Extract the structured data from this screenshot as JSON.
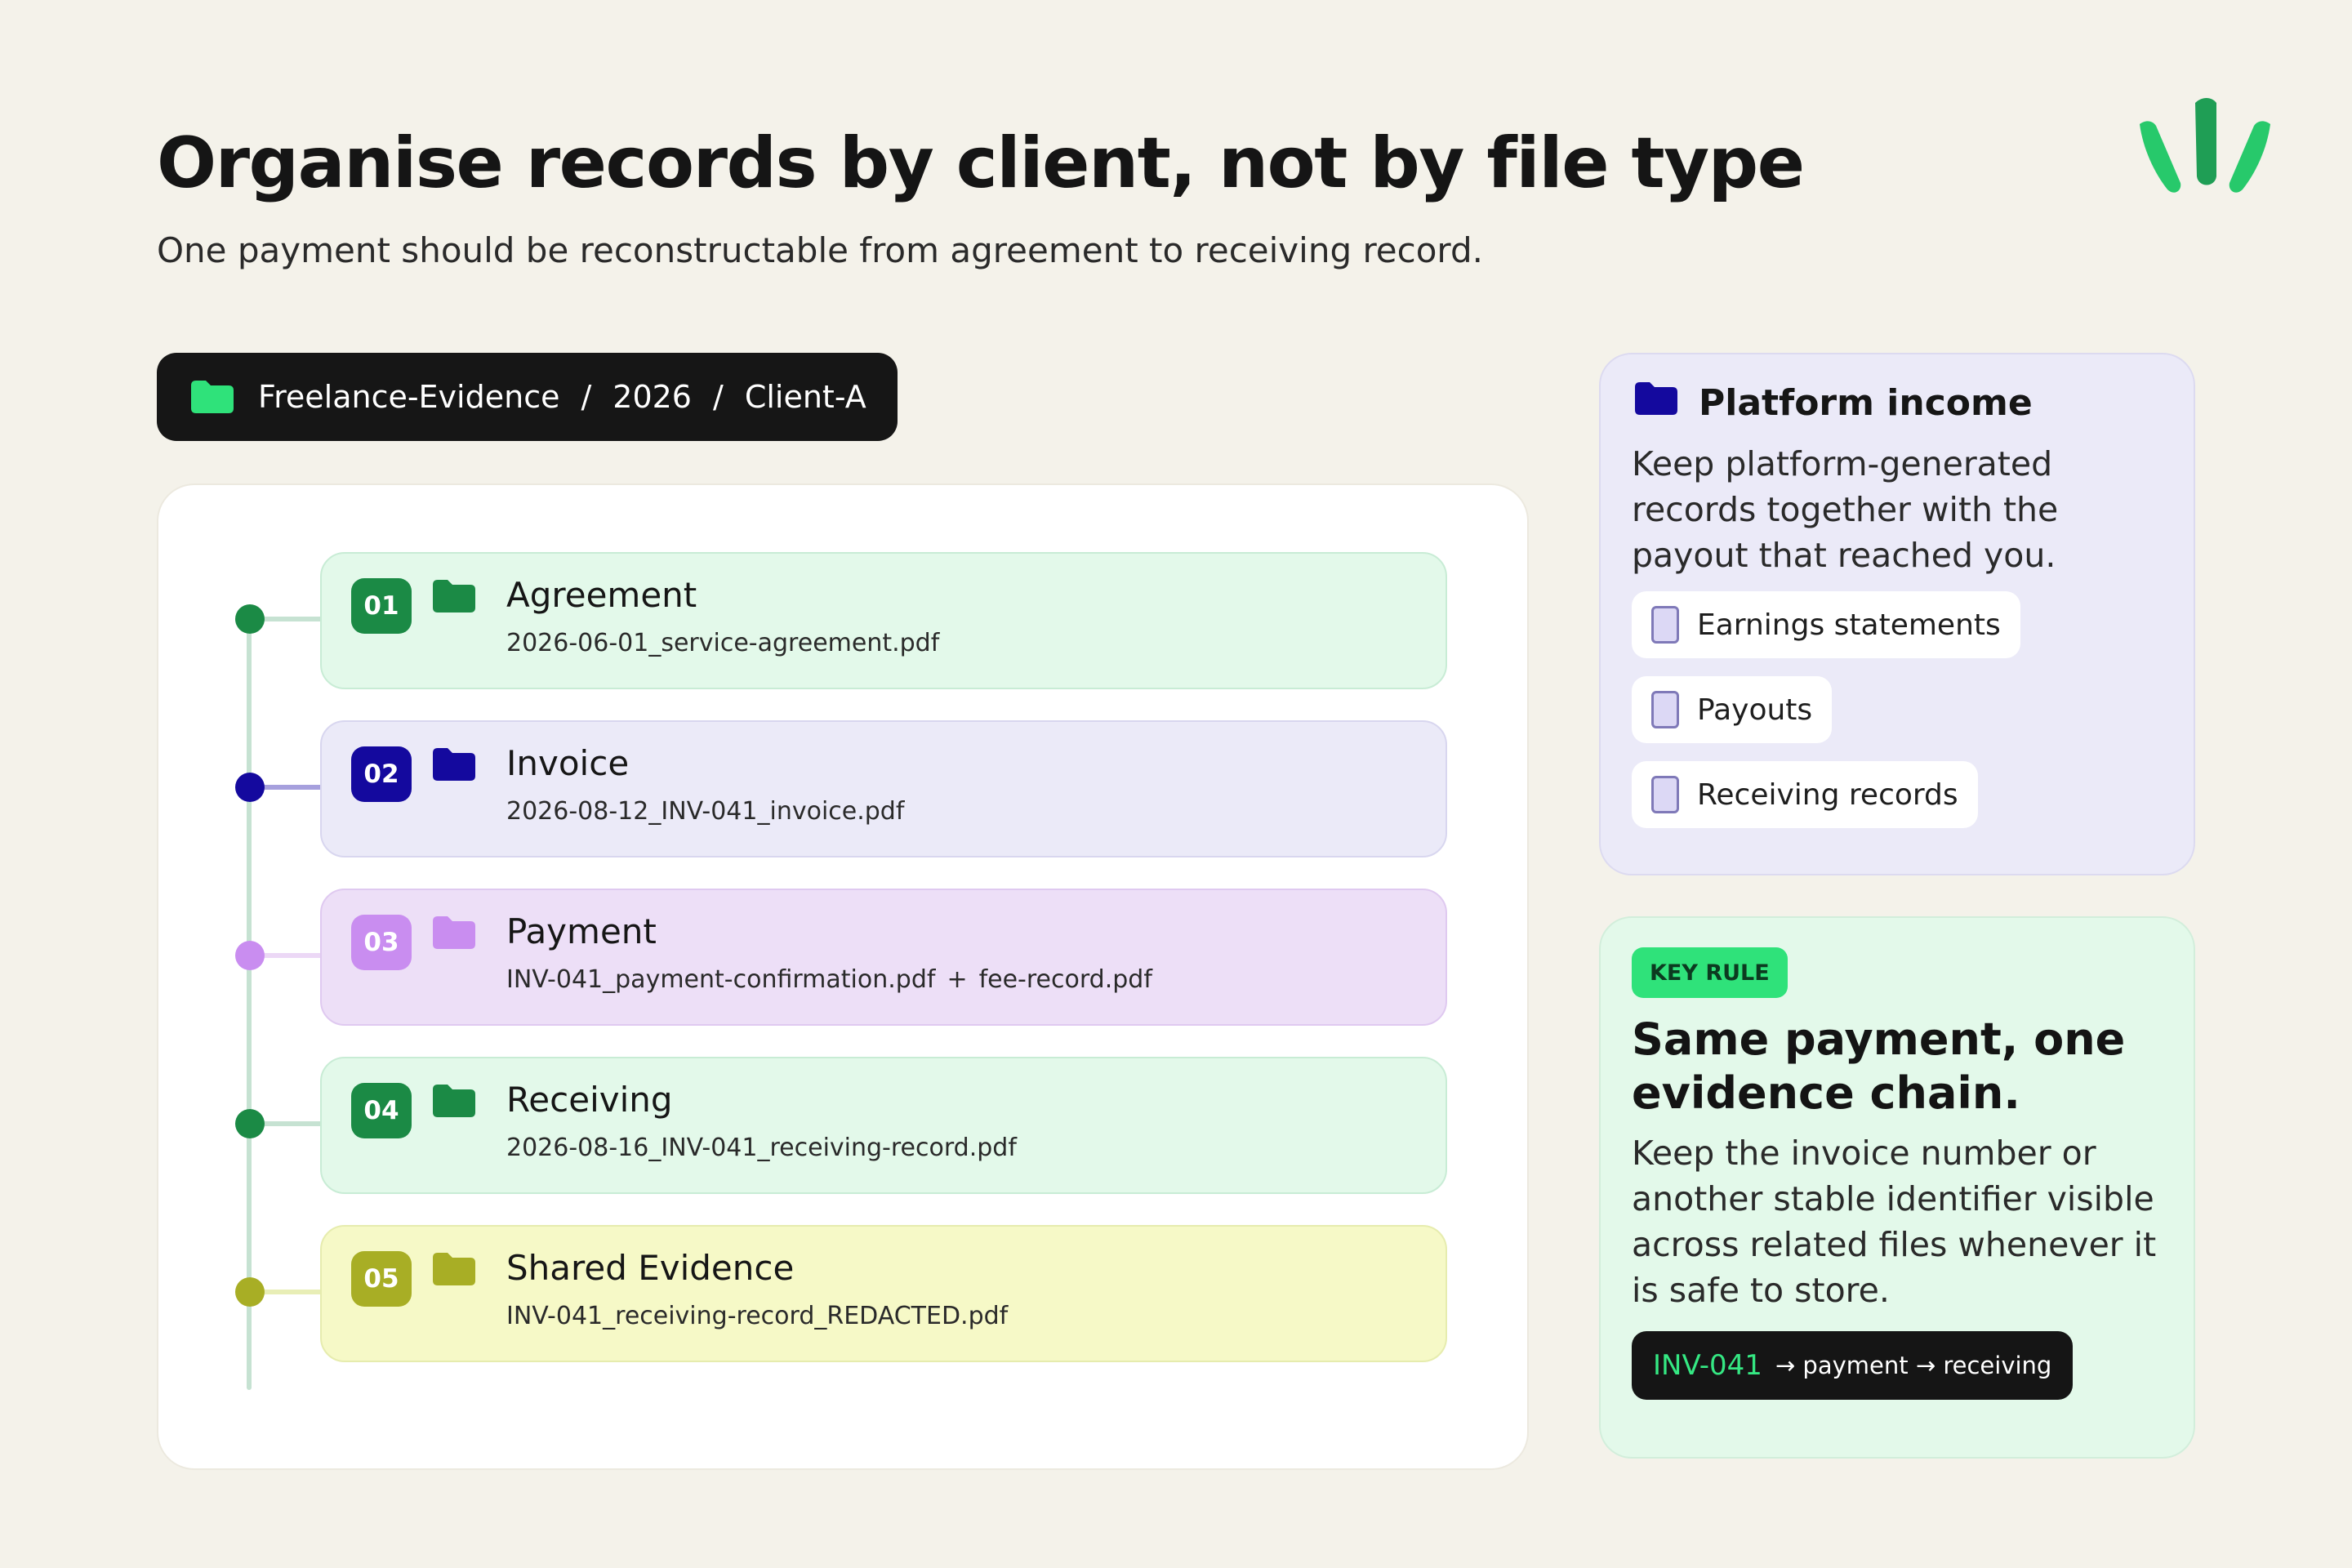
{
  "header": {
    "title": "Organise records by client, not by file type",
    "subtitle": "One payment should be reconstructable from agreement to receiving record."
  },
  "logo": {
    "icon": "leaf-sprout-icon",
    "color": "#2fe27a"
  },
  "breadcrumb": {
    "icon": "folder-icon",
    "items": [
      "Freelance-Evidence",
      "2026",
      "Client-A"
    ],
    "separator": "/"
  },
  "steps": [
    {
      "number": "01",
      "title": "Agreement",
      "files": [
        "2026-06-01_service-agreement.pdf"
      ],
      "icon": "folder-icon",
      "accent": "#1b8a45",
      "bg": "#e3f9ea",
      "border": "#c8ecd5",
      "link": "#c6e2d2"
    },
    {
      "number": "02",
      "title": "Invoice",
      "files": [
        "2026-08-12_INV-041_invoice.pdf"
      ],
      "icon": "folder-icon",
      "accent": "#14099e",
      "bg": "#ebeaf8",
      "border": "#d8d6ef",
      "link": "#a6a0dd"
    },
    {
      "number": "03",
      "title": "Payment",
      "files": [
        "INV-041_payment-confirmation.pdf",
        "fee-record.pdf"
      ],
      "joiner": "+",
      "icon": "folder-icon",
      "accent": "#c98df0",
      "bg": "#eddff7",
      "border": "#dfc9f0",
      "link": "#ecd8f6"
    },
    {
      "number": "04",
      "title": "Receiving",
      "files": [
        "2026-08-16_INV-041_receiving-record.pdf"
      ],
      "icon": "folder-icon",
      "accent": "#1b8a45",
      "bg": "#e3f9ea",
      "border": "#c8ecd5",
      "link": "#c6e2d2"
    },
    {
      "number": "05",
      "title": "Shared Evidence",
      "files": [
        "INV-041_receiving-record_REDACTED.pdf"
      ],
      "icon": "folder-icon",
      "accent": "#a8ae25",
      "bg": "#f6f9c7",
      "border": "#e6ecae",
      "link": "#e8eeb6"
    }
  ],
  "platform": {
    "icon": "folder-icon",
    "title": "Platform income",
    "description": "Keep platform-generated records together with the payout that reached you.",
    "items": [
      "Earnings statements",
      "Payouts",
      "Receiving records"
    ],
    "accent": "#14099e"
  },
  "rule": {
    "tag": "KEY RULE",
    "title": "Same payment, one evidence chain.",
    "description": "Keep the invoice number or another stable identifier visible across related files whenever it is safe to store.",
    "chain_id": "INV-041",
    "chain_rest": "→ payment → receiving"
  }
}
